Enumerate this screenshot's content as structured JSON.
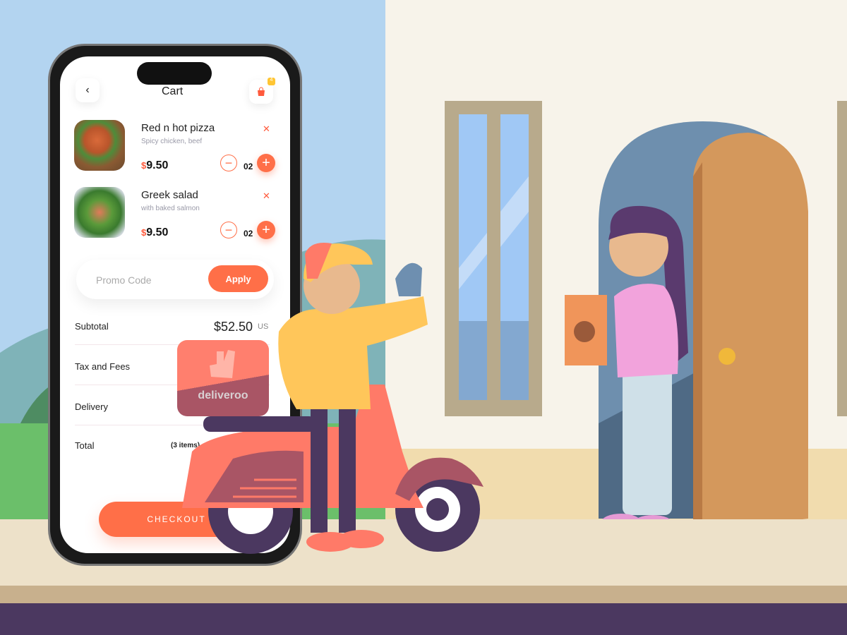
{
  "cart": {
    "title": "Cart",
    "back_icon": "chevron-left-icon",
    "bag_icon": "shopping-bag-icon",
    "bag_badge": "4",
    "items": [
      {
        "name": "Red n hot pizza",
        "description": "Spicy chicken, beef",
        "currency": "$",
        "price": "9.50",
        "quantity": "02"
      },
      {
        "name": "Greek salad",
        "description": "with baked salmon",
        "currency": "$",
        "price": "9.50",
        "quantity": "02"
      }
    ],
    "promo": {
      "placeholder": "Promo Code",
      "apply_label": "Apply"
    },
    "summary": {
      "subtotal_label": "Subtotal",
      "subtotal_value": "$52.50",
      "subtotal_unit": "US",
      "tax_label": "Tax and Fees",
      "delivery_label": "Delivery",
      "total_label": "Total",
      "total_items": "(3 items)"
    },
    "checkout_label": "CHECKOUT"
  },
  "brand": {
    "name": "deliveroo"
  },
  "colors": {
    "accent": "#ff6f48",
    "sky": "#b3d4f0",
    "wall": "#f7f3ea",
    "bottom_band": "#4b3860"
  }
}
